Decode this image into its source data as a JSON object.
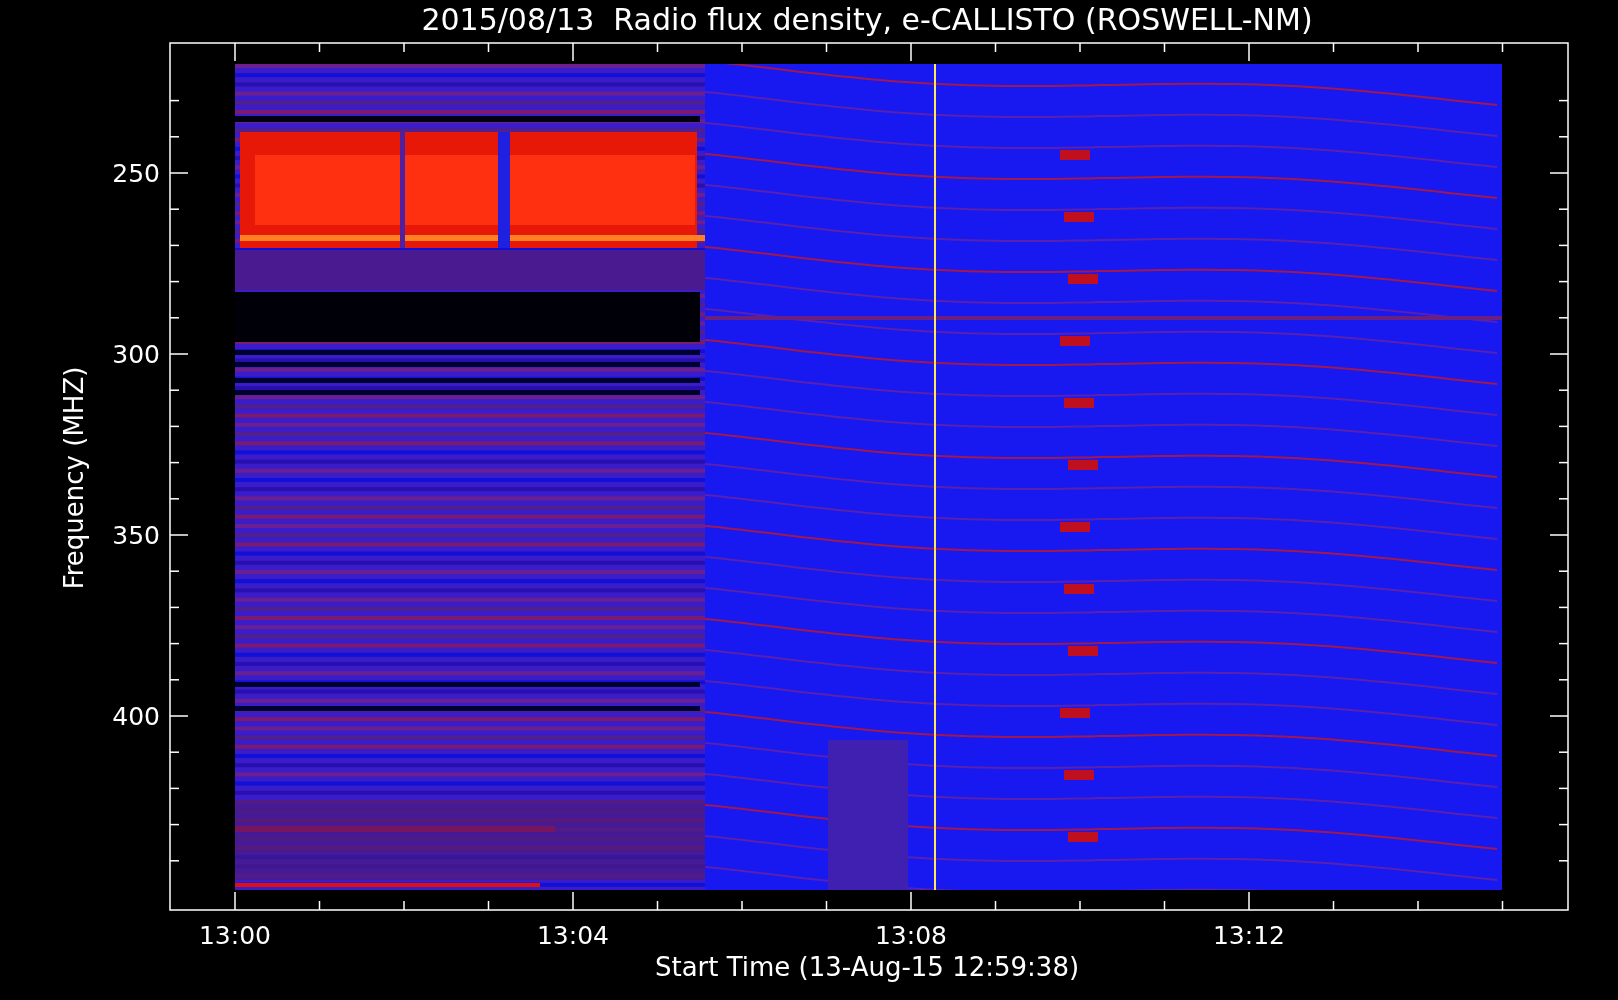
{
  "title": "2015/08/13  Radio flux density, e-CALLISTO (ROSWELL-NM)",
  "y_axis": {
    "label": "Frequency (MHZ)",
    "ticks": [
      "250",
      "300",
      "350",
      "400"
    ]
  },
  "x_axis": {
    "label": "Start Time (13-Aug-15 12:59:38)",
    "ticks": [
      "13:00",
      "13:04",
      "13:08",
      "13:12"
    ]
  }
}
